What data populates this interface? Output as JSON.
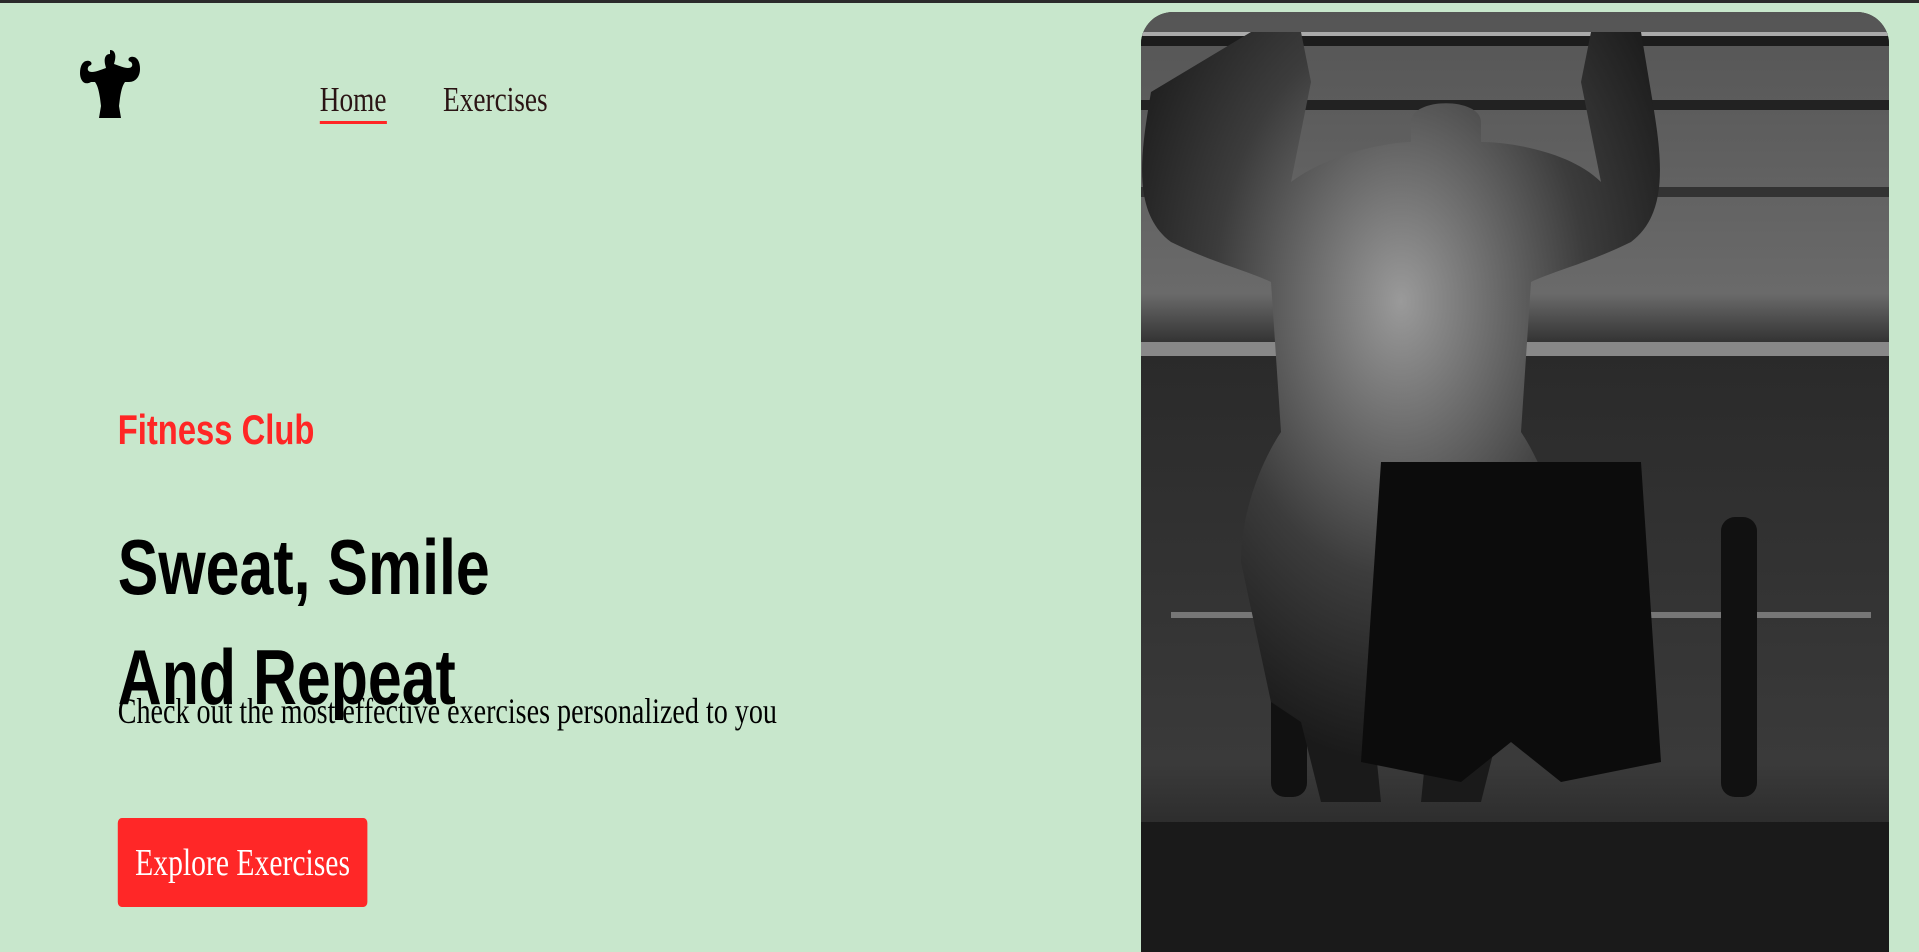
{
  "nav": {
    "logo_alt": "bodybuilder logo",
    "items": [
      {
        "label": "Home",
        "active": true
      },
      {
        "label": "Exercises",
        "active": false
      }
    ]
  },
  "hero": {
    "eyebrow": "Fitness Club",
    "headline_line1": "Sweat, Smile",
    "headline_line2": "And Repeat",
    "description": "Check out the most effective exercises personalized to you",
    "cta_label": "Explore Exercises"
  },
  "colors": {
    "background": "#c8e7cc",
    "accent": "#ff2625",
    "text": "#000000"
  }
}
